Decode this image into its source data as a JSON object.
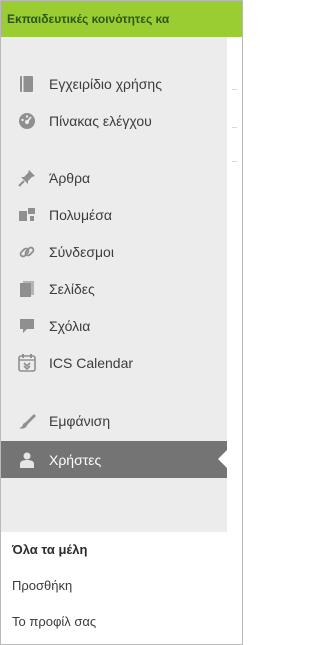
{
  "header": {
    "title": "Εκπαιδευτικές κοινότητες κα"
  },
  "sidebar": {
    "items": [
      {
        "label": "Εγχειρίδιο χρήσης",
        "icon": "book-icon"
      },
      {
        "label": "Πίνακας ελέγχου",
        "icon": "dashboard-icon"
      },
      {
        "label": "Άρθρα",
        "icon": "pin-icon"
      },
      {
        "label": "Πολυμέσα",
        "icon": "media-icon"
      },
      {
        "label": "Σύνδεσμοι",
        "icon": "link-icon"
      },
      {
        "label": "Σελίδες",
        "icon": "pages-icon"
      },
      {
        "label": "Σχόλια",
        "icon": "comment-icon"
      },
      {
        "label": "ICS Calendar",
        "icon": "calendar-icon"
      },
      {
        "label": "Εμφάνιση",
        "icon": "appearance-icon"
      },
      {
        "label": "Χρήστες",
        "icon": "users-icon",
        "active": true
      }
    ],
    "submenu": [
      {
        "label": "Όλα τα μέλη",
        "current": true
      },
      {
        "label": "Προσθήκη"
      },
      {
        "label": "Το προφίλ σας"
      }
    ]
  },
  "colors": {
    "topbar": "#9acd32",
    "sidebar_bg": "#ececec",
    "active_bg": "#747474",
    "icon": "#8f8f8f"
  }
}
